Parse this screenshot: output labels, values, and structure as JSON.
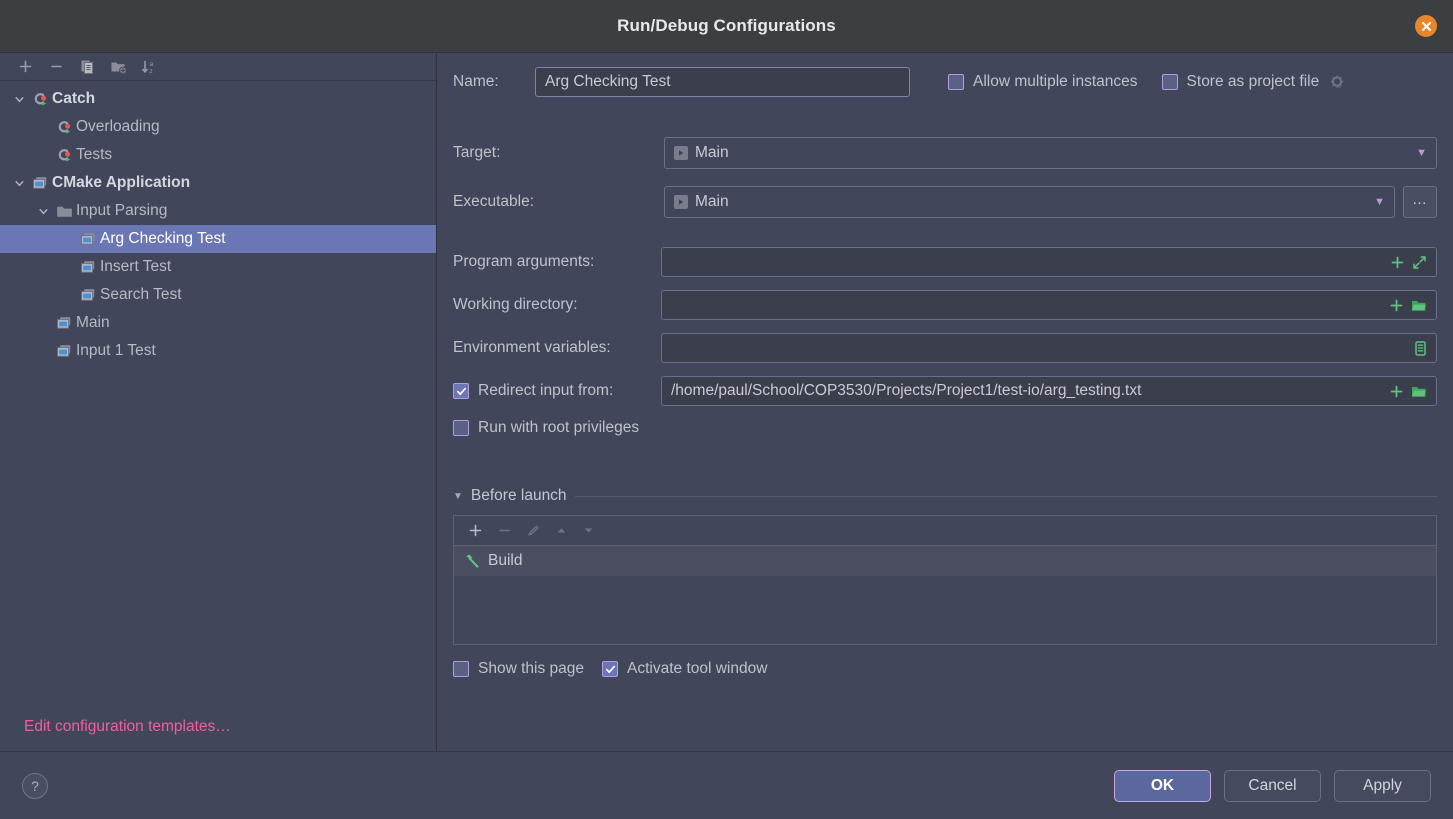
{
  "window": {
    "title": "Run/Debug Configurations",
    "close_icon": "close-icon"
  },
  "sidebar": {
    "toolbar": [
      {
        "name": "add-configuration-button",
        "icon": "plus-icon",
        "label": "+"
      },
      {
        "name": "remove-configuration-button",
        "icon": "minus-icon",
        "label": "−"
      },
      {
        "name": "copy-configuration-button",
        "icon": "copy-icon",
        "label": "Copy"
      },
      {
        "name": "new-folder-button",
        "icon": "folder-add-icon",
        "label": "New Folder"
      },
      {
        "name": "sort-configurations-button",
        "icon": "sort-alphabetical-icon",
        "label": "Sort"
      }
    ],
    "tree": [
      {
        "label": "Catch",
        "icon": "catch-test-icon",
        "indent": 0,
        "twisty": "expanded",
        "bold": true,
        "selected": false
      },
      {
        "label": "Overloading",
        "icon": "catch-test-icon",
        "indent": 1,
        "twisty": "none",
        "bold": false,
        "selected": false
      },
      {
        "label": "Tests",
        "icon": "catch-test-icon",
        "indent": 1,
        "twisty": "none",
        "bold": false,
        "selected": false
      },
      {
        "label": "CMake Application",
        "icon": "cmake-application-icon",
        "indent": 0,
        "twisty": "expanded",
        "bold": true,
        "selected": false
      },
      {
        "label": "Input Parsing",
        "icon": "folder-icon",
        "indent": 1,
        "twisty": "expanded",
        "bold": false,
        "selected": false
      },
      {
        "label": "Arg Checking Test",
        "icon": "cmake-application-icon",
        "indent": 2,
        "twisty": "none",
        "bold": false,
        "selected": true
      },
      {
        "label": "Insert Test",
        "icon": "cmake-application-icon",
        "indent": 2,
        "twisty": "none",
        "bold": false,
        "selected": false
      },
      {
        "label": "Search Test",
        "icon": "cmake-application-icon",
        "indent": 2,
        "twisty": "none",
        "bold": false,
        "selected": false
      },
      {
        "label": "Main",
        "icon": "cmake-application-icon",
        "indent": 1,
        "twisty": "none",
        "bold": false,
        "selected": false
      },
      {
        "label": "Input 1 Test",
        "icon": "cmake-application-icon",
        "indent": 1,
        "twisty": "none",
        "bold": false,
        "selected": false
      }
    ],
    "edit_templates_link": "Edit configuration templates…"
  },
  "form": {
    "name_label": "Name:",
    "name_value": "Arg Checking Test",
    "allow_multiple_instances": {
      "label": "Allow multiple instances",
      "checked": false
    },
    "store_as_project_file": {
      "label": "Store as project file",
      "checked": false
    },
    "target_label": "Target:",
    "target_value": "Main",
    "executable_label": "Executable:",
    "executable_value": "Main",
    "executable_browse_label": "…",
    "program_arguments_label": "Program arguments:",
    "program_arguments_value": "",
    "working_directory_label": "Working directory:",
    "working_directory_value": "",
    "environment_variables_label": "Environment variables:",
    "environment_variables_value": "",
    "redirect_input": {
      "label": "Redirect input from:",
      "checked": true,
      "value": "/home/paul/School/COP3530/Projects/Project1/test-io/arg_testing.txt"
    },
    "run_with_root_privileges": {
      "label": "Run with root privileges",
      "checked": false
    }
  },
  "before_launch": {
    "section_title": "Before launch",
    "toolbar": [
      {
        "name": "add-task-button",
        "label": "+",
        "enabled": true
      },
      {
        "name": "remove-task-button",
        "label": "−",
        "enabled": false
      },
      {
        "name": "edit-task-button",
        "label": "Edit",
        "enabled": false
      },
      {
        "name": "move-task-up-button",
        "label": "▲",
        "enabled": false
      },
      {
        "name": "move-task-down-button",
        "label": "▼",
        "enabled": false
      }
    ],
    "tasks": [
      {
        "label": "Build",
        "icon": "build-hammer-icon"
      }
    ],
    "show_this_page": {
      "label": "Show this page",
      "checked": false
    },
    "activate_tool_window": {
      "label": "Activate tool window",
      "checked": true
    }
  },
  "footer": {
    "help_label": "?",
    "ok_label": "OK",
    "cancel_label": "Cancel",
    "apply_label": "Apply"
  },
  "colors": {
    "dialog_bg": "#42465a",
    "titlebar_bg": "#3c3f41",
    "selection_blue": "#6b77b5",
    "accent_pink": "#ef5f9e",
    "close_orange": "#e8862a",
    "green_icon": "#5fc27e",
    "checkbox_border": "#b39ddb"
  }
}
